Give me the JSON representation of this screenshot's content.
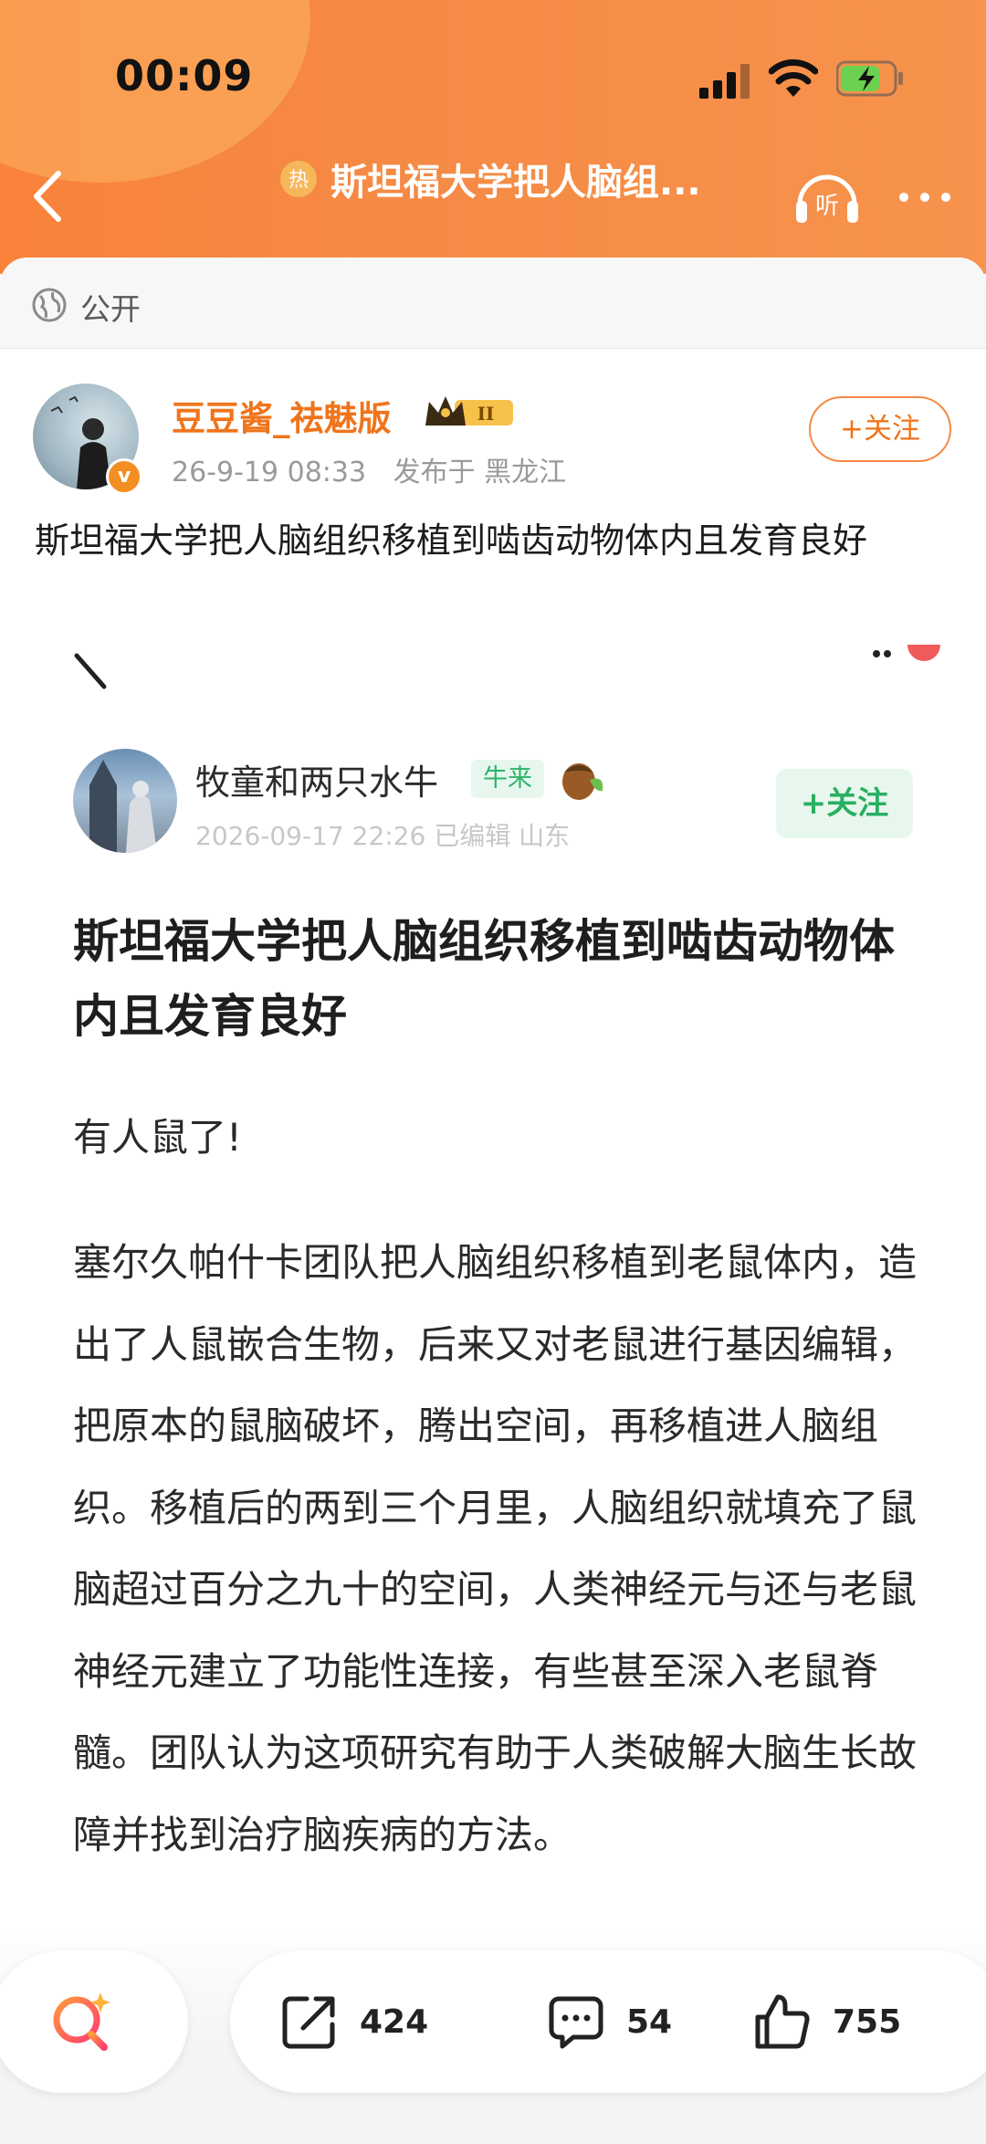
{
  "status_bar": {
    "time": "00:09"
  },
  "nav": {
    "title": "斯坦福大学把人脑组..."
  },
  "visibility": {
    "label": "公开"
  },
  "author": {
    "name": "豆豆酱_祛魅版",
    "level": "II",
    "date": "26-9-19 08:33",
    "location": "发布于 黑龙江",
    "follow_label": "+关注"
  },
  "post": {
    "title": "斯坦福大学把人脑组织移植到啮齿动物体内且发育良好"
  },
  "embedded": {
    "author_name": "牧童和两只水牛",
    "badge": "牛来",
    "meta": "2026-09-17 22:26  已编辑  山东",
    "follow_label": "+关注",
    "title": "斯坦福大学把人脑组织移植到啮齿动物体内且发育良好",
    "para1": "有人鼠了!",
    "para2": "塞尔久帕什卡团队把人脑组织移植到老鼠体内，造出了人鼠嵌合生物，后来又对老鼠进行基因编辑，把原本的鼠脑破坏，腾出空间，再移植进人脑组织。移植后的两到三个月里，人脑组织就填充了鼠脑超过百分之九十的空间，人类神经元与还与老鼠神经元建立了功能性连接，有些甚至深入老鼠脊髓。团队认为这项研究有助于人类破解大脑生长故障并找到治疗脑疾病的方法。"
  },
  "actions": {
    "share_count": "424",
    "comment_count": "54",
    "like_count": "755"
  },
  "colors": {
    "accent": "#f58a45",
    "brand_orange": "#f0741b",
    "green": "#2db46a"
  }
}
